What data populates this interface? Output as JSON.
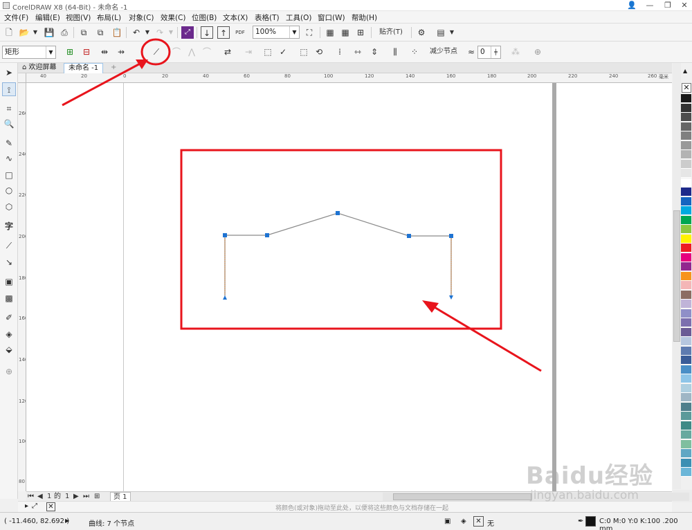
{
  "window": {
    "title": "CorelDRAW X8 (64-Bit) - 未命名 -1",
    "min_glyph": "—",
    "restore_glyph": "❐",
    "close_glyph": "✕"
  },
  "menu": [
    "文件(F)",
    "编辑(E)",
    "视图(V)",
    "布局(L)",
    "对象(C)",
    "效果(C)",
    "位图(B)",
    "文本(X)",
    "表格(T)",
    "工具(O)",
    "窗口(W)",
    "帮助(H)"
  ],
  "toolbar": {
    "zoom_value": "100%",
    "snap_label": "贴齐(T)",
    "pdf_label": "PDF"
  },
  "propertybar": {
    "shape_select": "矩形",
    "reduce_nodes_label": "减少节点",
    "smoothness_value": "0"
  },
  "tabs": {
    "welcome": "欢迎屏幕",
    "document": "未命名 -1",
    "add": "+"
  },
  "ruler": {
    "h_labels": [
      "40",
      "20",
      "0",
      "20",
      "40",
      "60",
      "80",
      "100",
      "120",
      "140",
      "160",
      "180",
      "200",
      "220",
      "240",
      "260"
    ],
    "unit": "毫米",
    "v_labels": [
      "260",
      "240",
      "220",
      "200",
      "180",
      "160",
      "140",
      "120",
      "100",
      "80"
    ]
  },
  "pagenav": {
    "current": "1",
    "of_label": "的",
    "total": "1",
    "page_tab": "页 1"
  },
  "docpalette": {
    "hint": "将颜色(或对象)拖动至此处，以便将这些颜色与文档存储在一起"
  },
  "status": {
    "coordinates": "( -11.460, 82.692 )",
    "object_info": "曲线: 7 个节点",
    "fill_label": "无",
    "outline_info": "C:0 M:0 Y:0 K:100  .200 mm"
  },
  "drawing": {
    "curve_color": "#8a8a8a",
    "node_color": "#1e73d2",
    "annotation_color": "#e8141c",
    "node_count": 7
  },
  "palette_colors": [
    "#1a1a1a",
    "#333333",
    "#4d4d4d",
    "#666666",
    "#808080",
    "#999999",
    "#b3b3b3",
    "#cccccc",
    "#e6e6e6",
    "#ffffff",
    "#1e2a8a",
    "#1565c0",
    "#00a9e0",
    "#00a651",
    "#8dc63f",
    "#fff200",
    "#ed1c24",
    "#e6007e",
    "#92278f",
    "#f7941d",
    "#f4b6b6",
    "#8c6d62",
    "#c0b4d8",
    "#8f8fc8",
    "#7c6fae",
    "#6b5b95",
    "#b7c7df",
    "#5e7bb0",
    "#3a5c98",
    "#4a8fc7",
    "#8ec5e8",
    "#aecfe0",
    "#9fb6c5",
    "#4f7f8c",
    "#5b9a9a",
    "#3f8a86",
    "#67a99f",
    "#7fbf9f",
    "#5fa7c4",
    "#3b8fb3",
    "#6bb6d8"
  ],
  "watermark": {
    "main": "Baidu经验",
    "sub": "jingyan.baidu.com"
  }
}
